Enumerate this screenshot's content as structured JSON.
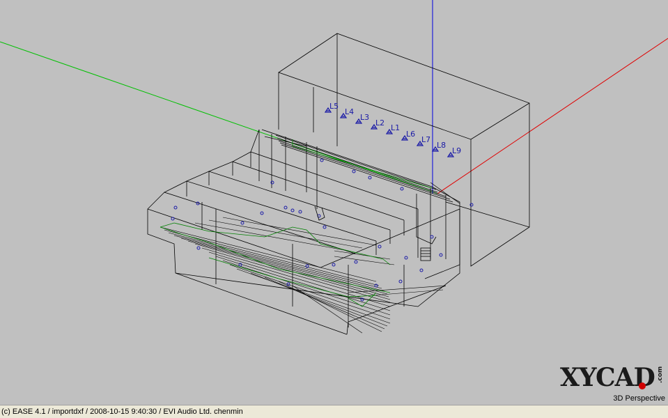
{
  "status_bar": {
    "text": "(c) EASE 4.1  / importdxf  / 2008-10-15 9:40:30 / EVI Audio Ltd. chenmin"
  },
  "view_mode": "3D Perspective",
  "logo": {
    "text": "XYCAD",
    "suffix": ".com"
  },
  "speakers": [
    {
      "label": "L5"
    },
    {
      "label": "L4"
    },
    {
      "label": "L3"
    },
    {
      "label": "L2"
    },
    {
      "label": "L1"
    },
    {
      "label": "L6"
    },
    {
      "label": "L7"
    },
    {
      "label": "L8"
    },
    {
      "label": "L9"
    }
  ],
  "colors": {
    "background": "#c0c0c0",
    "wireframe": "#000000",
    "axis_x": "#e00000",
    "axis_y": "#00c000",
    "axis_z": "#0000e0",
    "speaker": "#1a1aa6",
    "audience_area": "#008000",
    "status_bar": "#ece9d8"
  }
}
